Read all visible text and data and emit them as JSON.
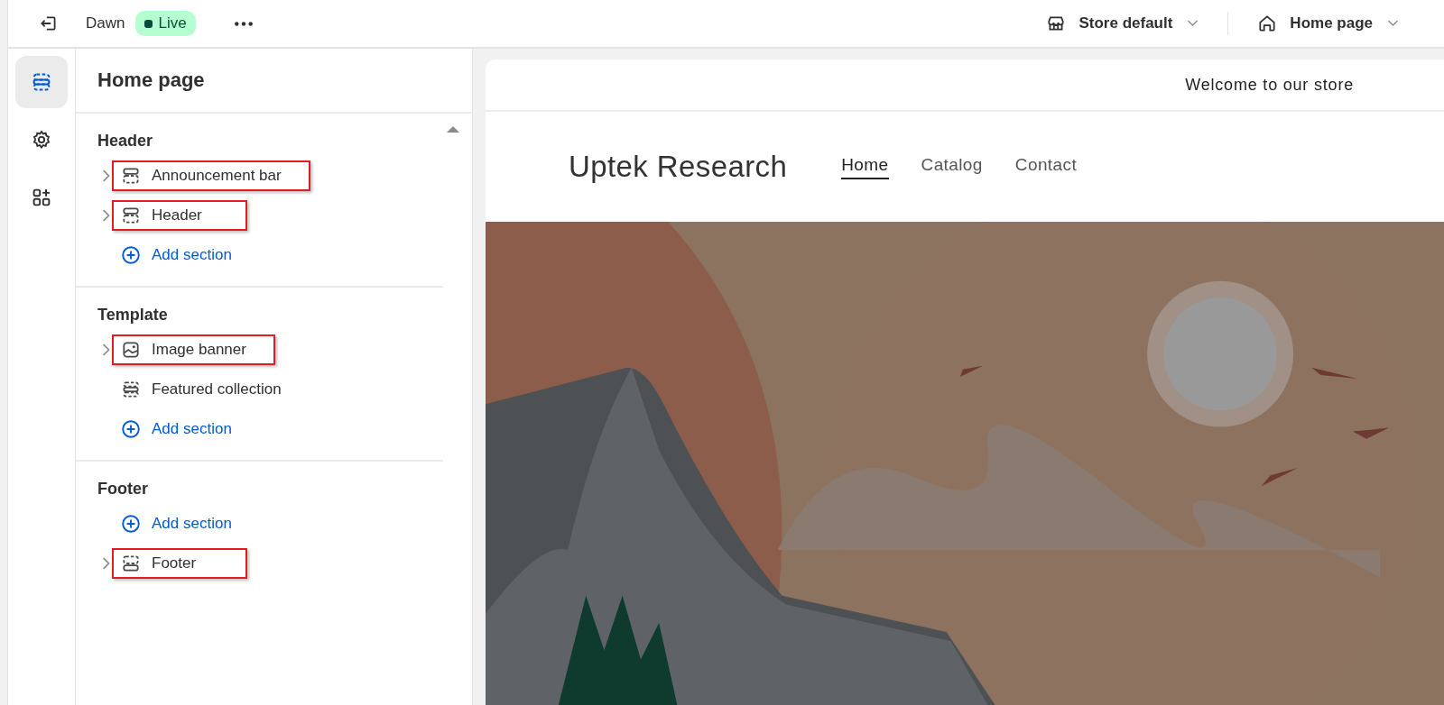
{
  "topbar": {
    "theme_name": "Dawn",
    "status_badge": "Live",
    "selectors": [
      {
        "kind": "store",
        "label": "Store default"
      },
      {
        "kind": "page",
        "label": "Home page"
      }
    ]
  },
  "rail": [
    {
      "kind": "sections",
      "selected": true
    },
    {
      "kind": "settings",
      "selected": false
    },
    {
      "kind": "apps",
      "selected": false
    }
  ],
  "sidebar": {
    "title": "Home page",
    "groups": [
      {
        "heading": "Header",
        "items": [
          {
            "kind": "top",
            "label": "Announcement bar",
            "expandable": true,
            "highlighted": true
          },
          {
            "kind": "top",
            "label": "Header",
            "expandable": true,
            "highlighted": true
          },
          {
            "kind": "add",
            "label": "Add section"
          }
        ]
      },
      {
        "heading": "Template",
        "items": [
          {
            "kind": "image",
            "label": "Image banner",
            "expandable": true,
            "highlighted": true
          },
          {
            "kind": "middle",
            "label": "Featured collection",
            "expandable": false,
            "highlighted": false
          },
          {
            "kind": "add",
            "label": "Add section"
          }
        ]
      },
      {
        "heading": "Footer",
        "items": [
          {
            "kind": "add",
            "label": "Add section"
          },
          {
            "kind": "bottom",
            "label": "Footer",
            "expandable": true,
            "highlighted": true
          }
        ]
      }
    ]
  },
  "preview": {
    "announcement": "Welcome to our store",
    "store_name": "Uptek Research",
    "nav": [
      {
        "label": "Home",
        "selected": true
      },
      {
        "label": "Catalog",
        "selected": false
      },
      {
        "label": "Contact",
        "selected": false
      }
    ]
  }
}
